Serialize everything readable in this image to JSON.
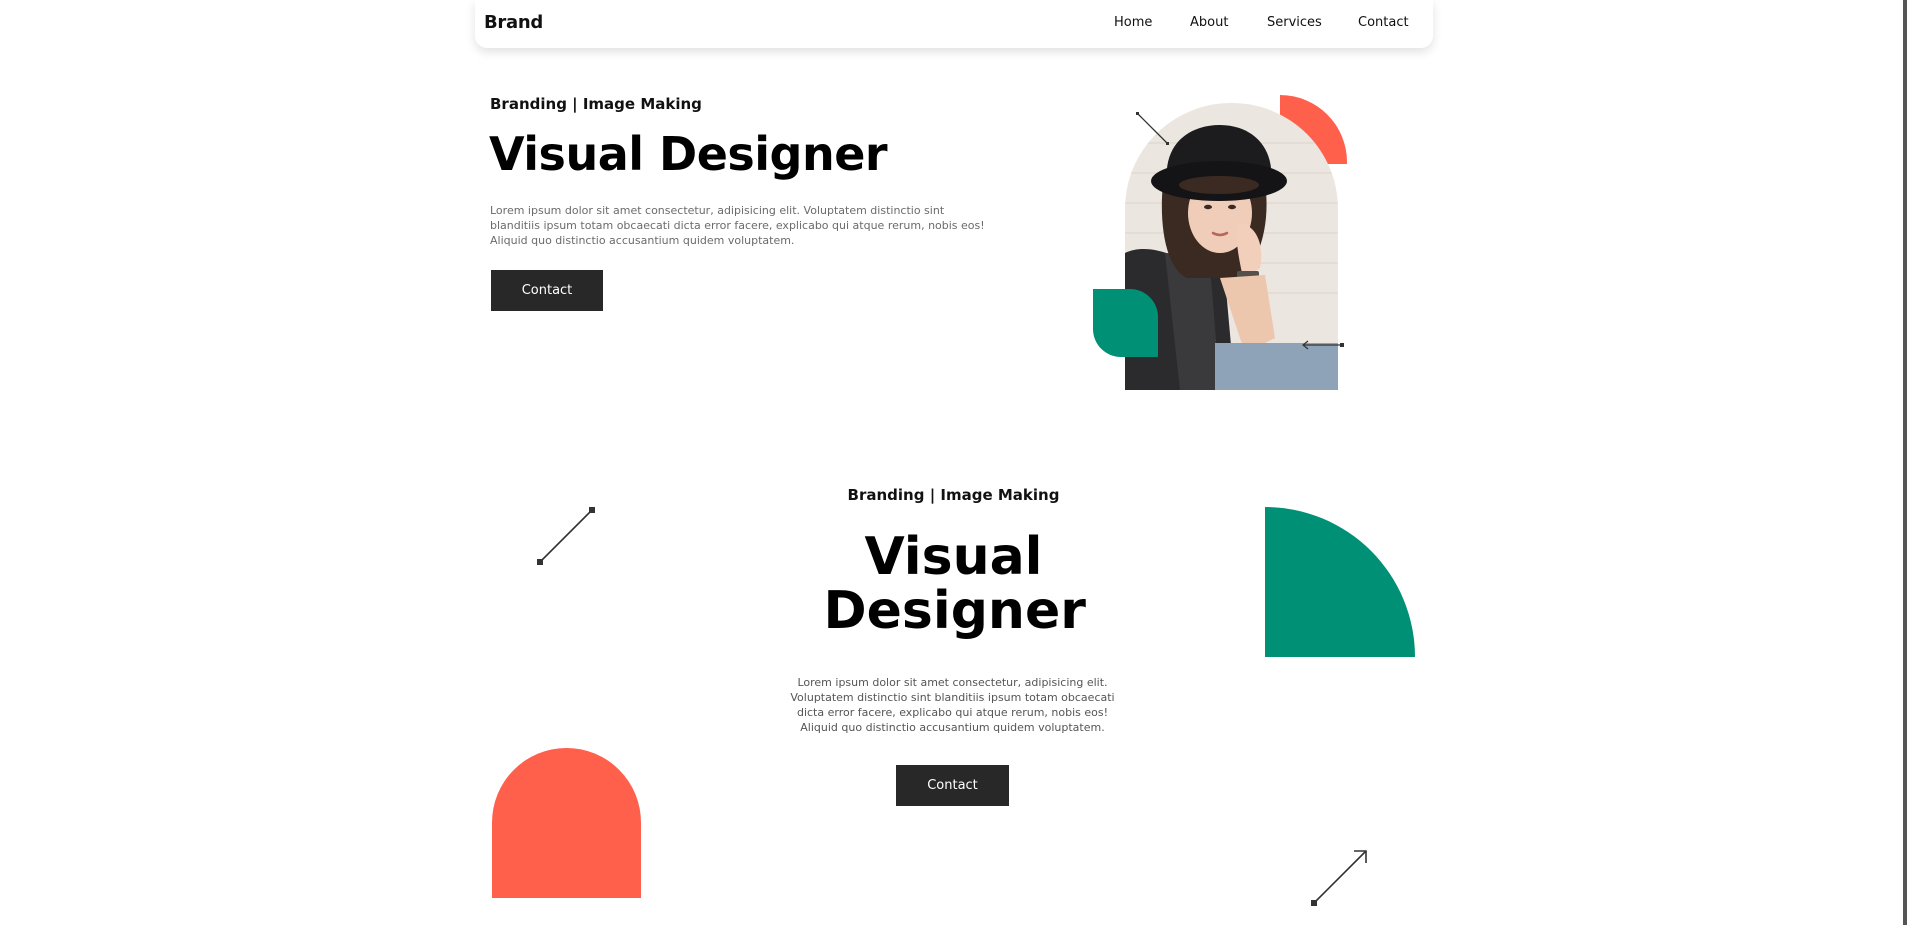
{
  "navbar": {
    "brand": "Brand",
    "links": [
      "Home",
      "About",
      "Services",
      "Contact"
    ]
  },
  "hero_primary": {
    "tagline": "Branding | Image Making",
    "title": "Visual Designer",
    "description": "Lorem ipsum dolor sit amet consectetur, adipisicing elit. Voluptatem distinctio sint blanditiis ipsum totam obcaecati dicta error facere, explicabo qui atque rerum, nobis eos! Aliquid quo distinctio accusantium quidem voluptatem.",
    "cta_label": "Contact"
  },
  "hero_secondary": {
    "tagline": "Branding | Image Making",
    "title": "Visual Designer",
    "description": "Lorem ipsum dolor sit amet consectetur, adipisicing elit. Voluptatem distinctio sint blanditiis ipsum totam obcaecati dicta error facere, explicabo qui atque rerum, nobis eos! Aliquid quo distinctio accusantium quidem voluptatem.",
    "cta_label": "Contact"
  },
  "colors": {
    "accent_coral": "#ff604c",
    "accent_green": "#009076",
    "button_dark": "#282828"
  },
  "icons": [
    "diagonal-line-icon",
    "double-arrow-icon",
    "diagonal-arrow-icon"
  ]
}
